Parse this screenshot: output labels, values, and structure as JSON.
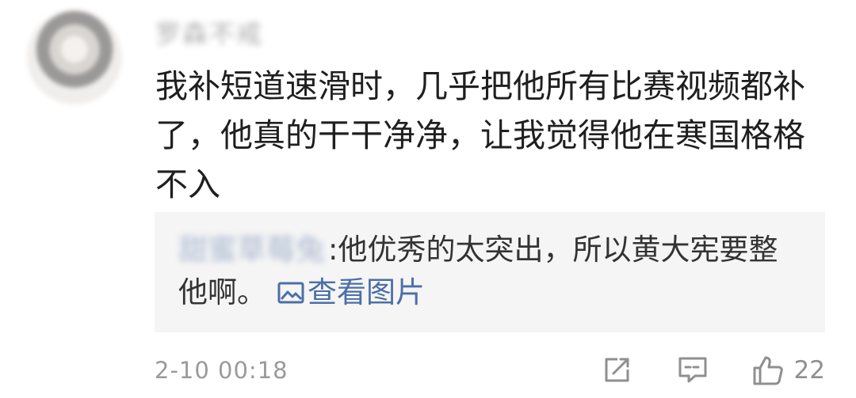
{
  "comment": {
    "username": "罗森不戒",
    "text": "我补短道速滑时，几乎把他所有比赛视频都补了，他真的干干净净，让我觉得他在寒国格格不入"
  },
  "reply": {
    "username": "甜蜜草莓兔",
    "separator": ":",
    "text": "他优秀的太突出，所以黄大宪要整他啊。",
    "image_link_label": "查看图片",
    "image_link_icon": "image-icon"
  },
  "footer": {
    "timestamp": "2-10 00:18",
    "share_icon": "share-icon",
    "comment_icon": "comment-icon",
    "like_icon": "thumb-up-icon",
    "like_count": "22"
  }
}
